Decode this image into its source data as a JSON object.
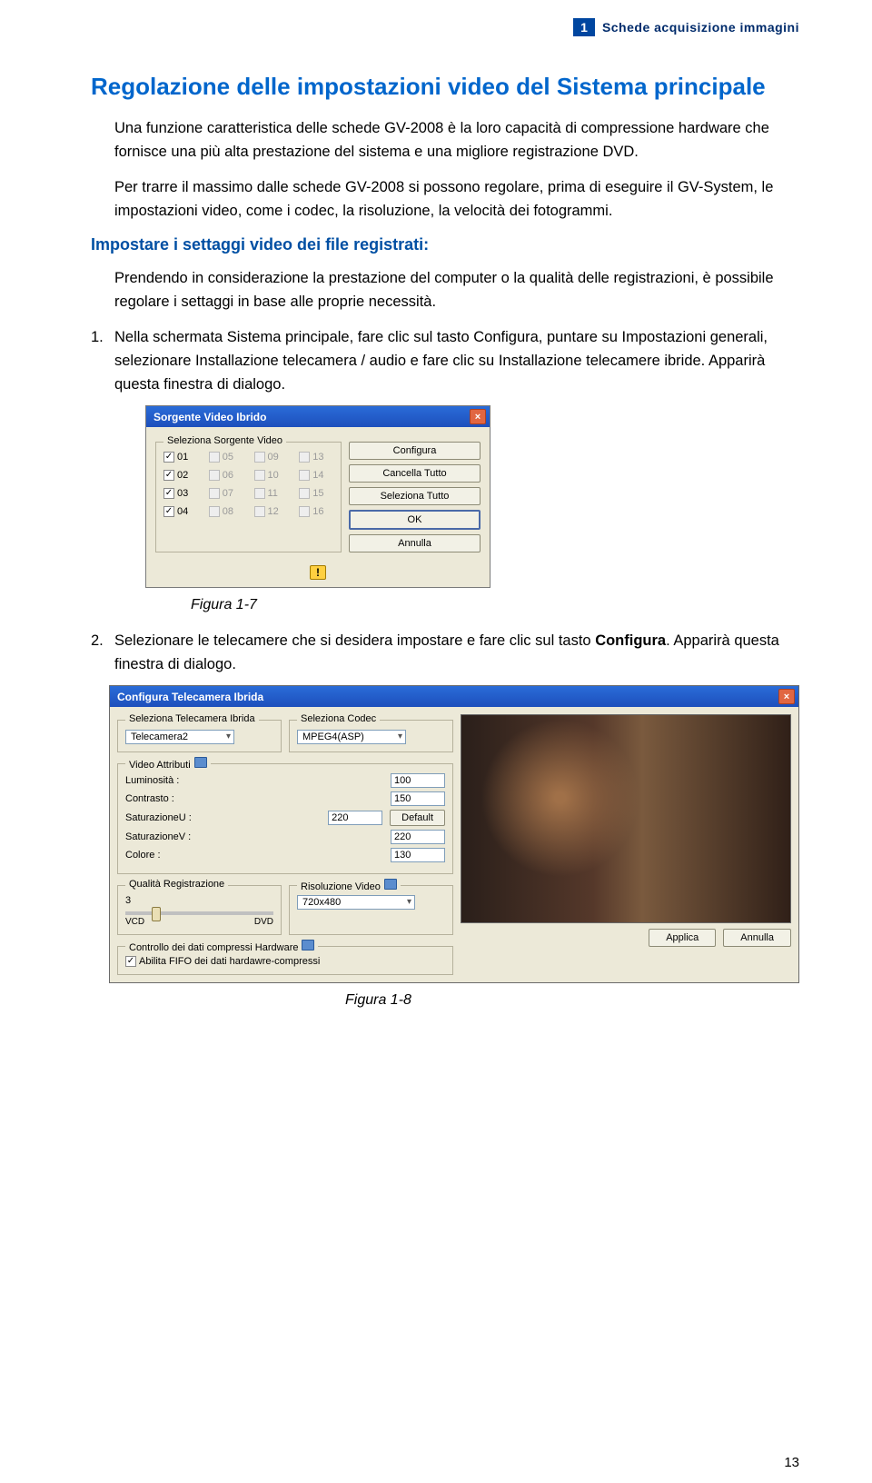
{
  "header": {
    "chapter_number": "1",
    "chapter_title": "Schede acquisizione immagini"
  },
  "section": {
    "title": "Regolazione delle impostazioni video del Sistema principale",
    "para1": "Una funzione caratteristica delle schede GV-2008 è la loro capacità di compressione hardware che fornisce una più alta prestazione del sistema e una migliore registrazione DVD.",
    "para2": "Per trarre il massimo dalle schede GV-2008 si possono regolare, prima di eseguire il GV-System, le impostazioni video, come i codec, la risoluzione, la velocità dei fotogrammi."
  },
  "subsection": {
    "title": "Impostare i settaggi video dei file registrati:",
    "para1": "Prendendo in considerazione la prestazione del computer o la qualità delle registrazioni, è possibile regolare i settaggi in base alle proprie necessità.",
    "step1_num": "1.",
    "step1": "Nella schermata Sistema principale, fare clic sul tasto Configura, puntare su Impostazioni generali, selezionare Installazione telecamera / audio e fare clic su Installazione telecamere ibride. Apparirà questa finestra di dialogo.",
    "step2_num": "2.",
    "step2_pre": "Selezionare le telecamere che si desidera impostare e fare clic sul tasto ",
    "step2_bold": "Configura",
    "step2_post": ". Apparirà questa finestra di dialogo."
  },
  "figures": {
    "fig1": "Figura 1-7",
    "fig2": "Figura 1-8"
  },
  "dialog1": {
    "title": "Sorgente Video Ibrido",
    "group_label": "Seleziona Sorgente Video",
    "checkboxes": [
      {
        "n": "01",
        "on": true
      },
      {
        "n": "05",
        "on": false,
        "dis": true
      },
      {
        "n": "09",
        "on": false,
        "dis": true
      },
      {
        "n": "13",
        "on": false,
        "dis": true
      },
      {
        "n": "02",
        "on": true
      },
      {
        "n": "06",
        "on": false,
        "dis": true
      },
      {
        "n": "10",
        "on": false,
        "dis": true
      },
      {
        "n": "14",
        "on": false,
        "dis": true
      },
      {
        "n": "03",
        "on": true
      },
      {
        "n": "07",
        "on": false,
        "dis": true
      },
      {
        "n": "11",
        "on": false,
        "dis": true
      },
      {
        "n": "15",
        "on": false,
        "dis": true
      },
      {
        "n": "04",
        "on": true
      },
      {
        "n": "08",
        "on": false,
        "dis": true
      },
      {
        "n": "12",
        "on": false,
        "dis": true
      },
      {
        "n": "16",
        "on": false,
        "dis": true
      }
    ],
    "buttons": {
      "configure": "Configura",
      "clear_all": "Cancella Tutto",
      "select_all": "Seleziona Tutto",
      "ok": "OK",
      "cancel": "Annulla"
    },
    "warn_icon": "!"
  },
  "dialog2": {
    "title": "Configura Telecamera Ibrida",
    "group_camera": "Seleziona Telecamera Ibrida",
    "group_codec": "Seleziona Codec",
    "combo_camera": "Telecamera2",
    "combo_codec": "MPEG4(ASP)",
    "group_attr": "Video Attributi",
    "attrs": {
      "brightness_l": "Luminosità :",
      "brightness_v": "100",
      "contrast_l": "Contrasto :",
      "contrast_v": "150",
      "satu_l": "SaturazioneU :",
      "satu_v": "220",
      "satv_l": "SaturazioneV :",
      "satv_v": "220",
      "color_l": "Colore :",
      "color_v": "130",
      "default_btn": "Default"
    },
    "group_quality": "Qualità Registrazione",
    "quality_val": "3",
    "vcd": "VCD",
    "dvd": "DVD",
    "group_res": "Risoluzione Video",
    "combo_res": "720x480",
    "group_hw": "Controllo dei dati compressi Hardware",
    "fifo_label": "Abilita FIFO dei dati hardawre-compressi",
    "apply": "Applica",
    "cancel": "Annulla"
  },
  "page_number": "13"
}
